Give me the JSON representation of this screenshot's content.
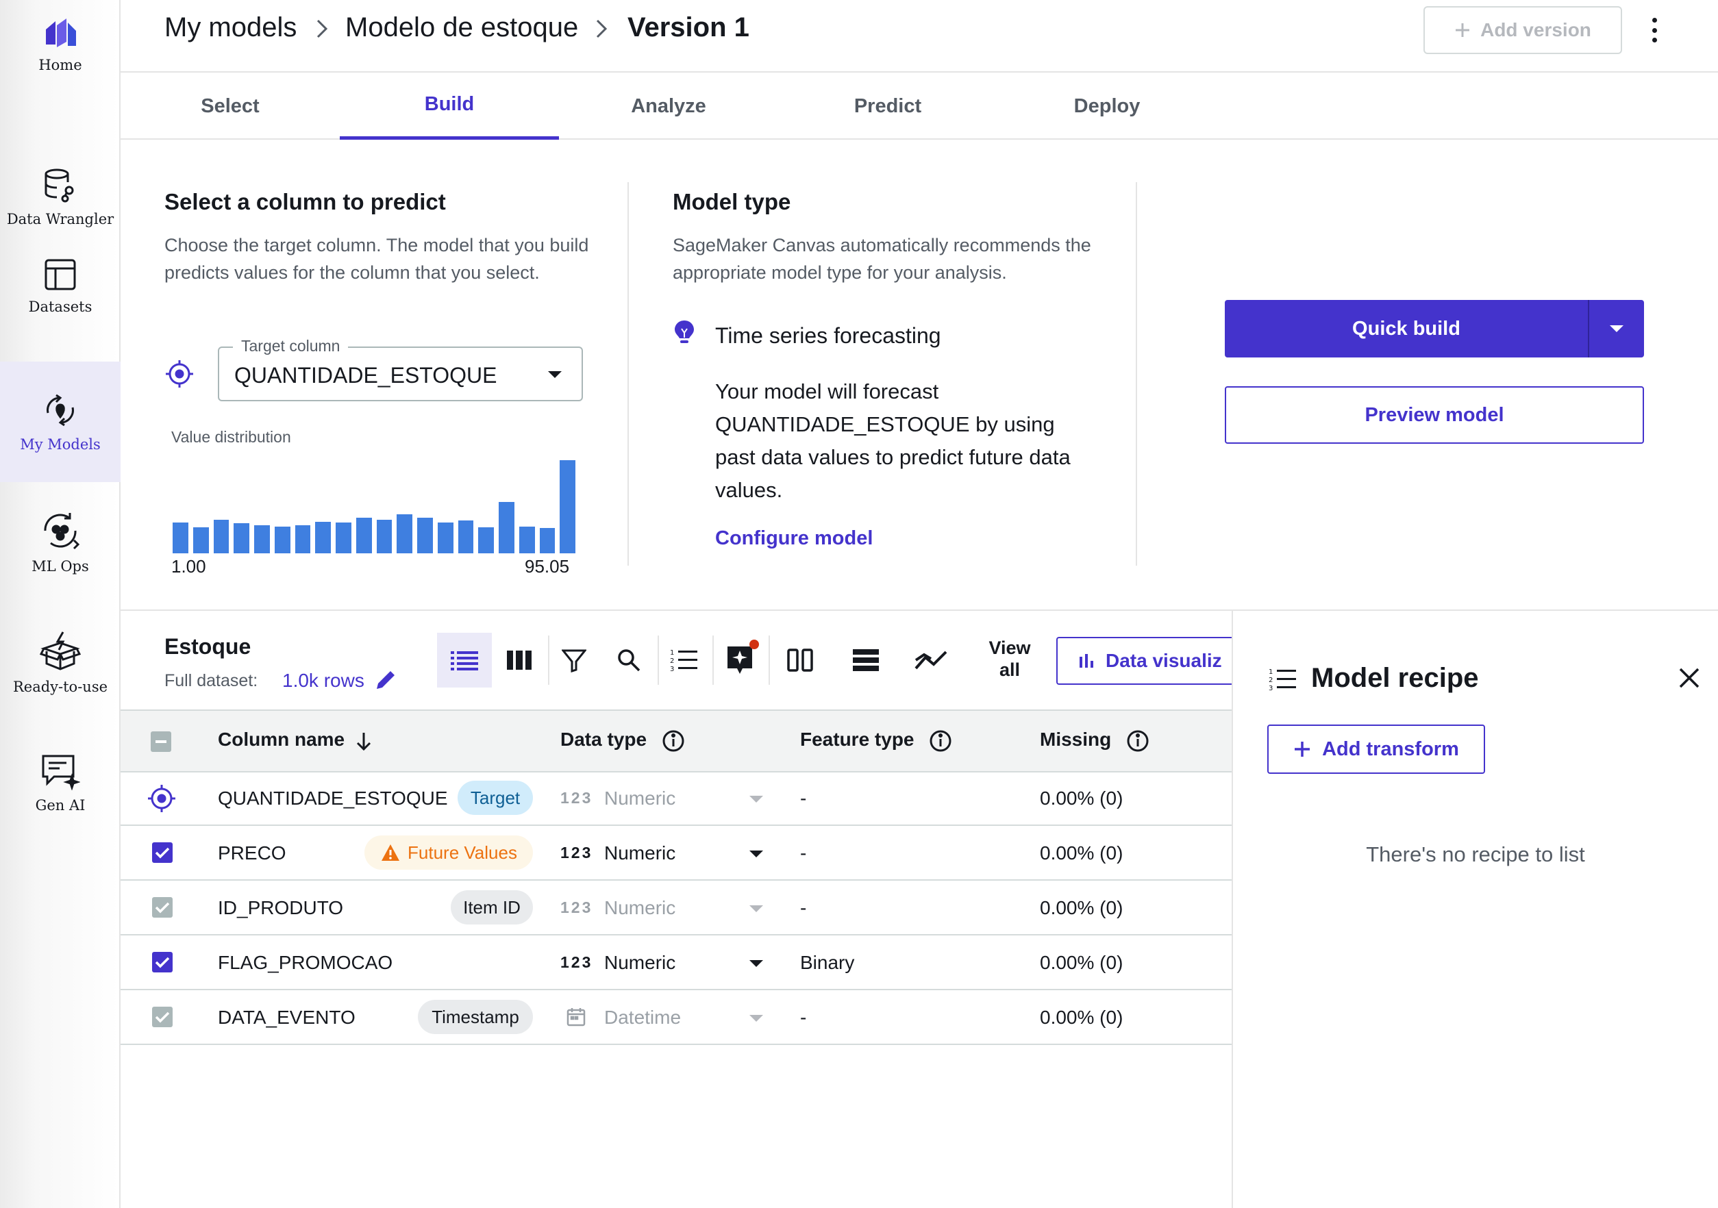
{
  "colors": {
    "accent": "#4433cc",
    "bar": "#3f7fe0",
    "warning": "#ec7211",
    "target_badge_bg": "#d1ecfb"
  },
  "sidebar": {
    "items": [
      {
        "label": "Home",
        "icon": "canvas-logo-icon"
      },
      {
        "label": "Data Wrangler",
        "icon": "data-wrangler-icon"
      },
      {
        "label": "Datasets",
        "icon": "datasets-icon"
      },
      {
        "label": "My Models",
        "icon": "my-models-icon",
        "active": true
      },
      {
        "label": "ML Ops",
        "icon": "ml-ops-icon"
      },
      {
        "label": "Ready-to-use",
        "icon": "ready-to-use-icon"
      },
      {
        "label": "Gen AI",
        "icon": "gen-ai-icon"
      }
    ]
  },
  "header": {
    "breadcrumb": [
      "My models",
      "Modelo de estoque",
      "Version 1"
    ],
    "add_version": "Add version"
  },
  "tabs": [
    {
      "label": "Select"
    },
    {
      "label": "Build",
      "active": true
    },
    {
      "label": "Analyze"
    },
    {
      "label": "Predict"
    },
    {
      "label": "Deploy"
    }
  ],
  "target": {
    "title": "Select a column to predict",
    "description": "Choose the target column. The model that you build predicts values for the column that you select.",
    "field_label": "Target column",
    "value": "QUANTIDADE_ESTOQUE",
    "distribution_label": "Value distribution",
    "range_min": "1.00",
    "range_max": "95.05",
    "histogram": [
      0.33,
      0.28,
      0.36,
      0.32,
      0.3,
      0.29,
      0.3,
      0.34,
      0.33,
      0.38,
      0.36,
      0.42,
      0.38,
      0.33,
      0.35,
      0.28,
      0.55,
      0.29,
      0.27,
      1.0
    ]
  },
  "model_type": {
    "title": "Model type",
    "description": "SageMaker Canvas automatically recommends the appropriate model type for your analysis.",
    "type": "Time series forecasting",
    "detail": "Your model will forecast QUANTIDADE_ESTOQUE by using past data values to predict future data values.",
    "configure": "Configure model"
  },
  "actions": {
    "quick_build": "Quick build",
    "preview": "Preview model"
  },
  "dataset": {
    "name": "Estoque",
    "full_label": "Full dataset:",
    "rows": "1.0k rows",
    "view_all": [
      "View",
      "all"
    ],
    "data_viz": "Data visualiz",
    "columns": {
      "name": "Column name",
      "data_type": "Data type",
      "feature_type": "Feature type",
      "missing": "Missing"
    },
    "rows_data": [
      {
        "name": "QUANTIDADE_ESTOQUE",
        "badge": "Target",
        "type_icon": "123",
        "data_type": "Numeric",
        "feature_type": "-",
        "missing": "0.00% (0)"
      },
      {
        "name": "PRECO",
        "badge": "Future Values",
        "type_icon": "123",
        "data_type": "Numeric",
        "feature_type": "-",
        "missing": "0.00% (0)"
      },
      {
        "name": "ID_PRODUTO",
        "badge": "Item ID",
        "type_icon": "123",
        "data_type": "Numeric",
        "feature_type": "-",
        "missing": "0.00% (0)"
      },
      {
        "name": "FLAG_PROMOCAO",
        "badge": "",
        "type_icon": "123",
        "data_type": "Numeric",
        "feature_type": "Binary",
        "missing": "0.00% (0)"
      },
      {
        "name": "DATA_EVENTO",
        "badge": "Timestamp",
        "type_icon": "calendar-icon",
        "data_type": "Datetime",
        "feature_type": "-",
        "missing": "0.00% (0)"
      }
    ]
  },
  "recipe": {
    "title": "Model recipe",
    "add": "Add transform",
    "empty": "There's no recipe to list"
  }
}
